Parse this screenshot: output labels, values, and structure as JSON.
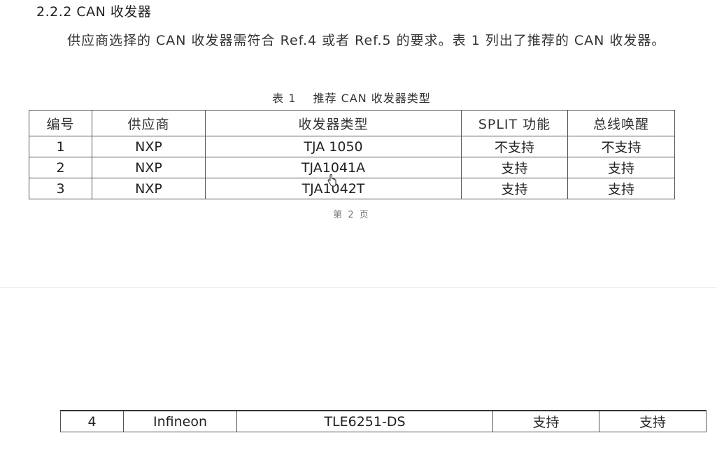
{
  "section": {
    "heading": "2.2.2 CAN 收发器",
    "paragraph": "供应商选择的 CAN 收发器需符合 Ref.4 或者 Ref.5 的要求。表 1 列出了推荐的 CAN 收发器。"
  },
  "table": {
    "caption_number": "表 1",
    "caption_title": "推荐 CAN 收发器类型",
    "headers": [
      "编号",
      "供应商",
      "收发器类型",
      "SPLIT 功能",
      "总线唤醒"
    ],
    "rows": [
      [
        "1",
        "NXP",
        "TJA 1050",
        "不支持",
        "不支持"
      ],
      [
        "2",
        "NXP",
        "TJA1041A",
        "支持",
        "支持"
      ],
      [
        "3",
        "NXP",
        "TJA1042T",
        "支持",
        "支持"
      ]
    ],
    "page_label": "第 2 页"
  },
  "continued_table": {
    "rows": [
      [
        "4",
        "Infineon",
        "TLE6251-DS",
        "支持",
        "支持"
      ]
    ]
  },
  "icons": {
    "cursor": "hand-pointer-icon"
  }
}
